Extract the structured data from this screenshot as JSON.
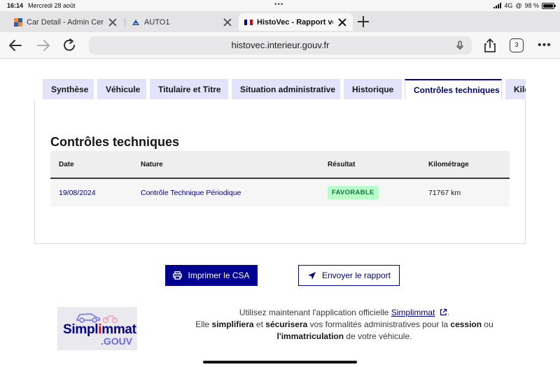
{
  "status_bar": {
    "time": "16:14",
    "date": "Mercredi 28 août",
    "network": "4G",
    "battery": "98 %"
  },
  "browser_tabs": [
    {
      "title": "Car Detail - Admin Center",
      "active": false
    },
    {
      "title": "AUTO1",
      "active": false
    },
    {
      "title": "HistoVec - Rapport vendeur",
      "active": true
    }
  ],
  "toolbar": {
    "url": "histovec.interieur.gouv.fr",
    "tab_count": "3"
  },
  "section_tabs": [
    {
      "label": "Synthèse"
    },
    {
      "label": "Véhicule"
    },
    {
      "label": "Titulaire et Titre"
    },
    {
      "label": "Situation administrative"
    },
    {
      "label": "Historique"
    },
    {
      "label": "Contrôles techniques"
    },
    {
      "label": "Kilométrage"
    }
  ],
  "panel": {
    "title": "Contrôles techniques",
    "columns": [
      "Date",
      "Nature",
      "Résultat",
      "Kilométrage"
    ],
    "rows": [
      {
        "date": "19/08/2024",
        "nature": "Contrôle Technique Périodique",
        "result": "FAVORABLE",
        "km": "71767 km"
      }
    ]
  },
  "actions": {
    "print": "Imprimer le CSA",
    "send": "Envoyer le rapport"
  },
  "promo": {
    "logo_word_1": "Simpl",
    "logo_word_2": "i",
    "logo_word_3": "mmat",
    "logo_gouv": ".GOUV",
    "line1_pre": "Utilisez maintenant l'application officielle ",
    "line1_link": "Simplimmat",
    "line1_post": ".",
    "line2_a": "Elle ",
    "line2_b": "simplifiera",
    "line2_c": " et ",
    "line2_d": "sécurisera",
    "line2_e": " vos formalités administratives pour la ",
    "line2_f": "cession",
    "line2_g": " ou",
    "line3_a": "l'immatriculation",
    "line3_b": " de votre véhicule."
  },
  "colors": {
    "primary": "#000091",
    "tab_bg": "#e3e3fd",
    "success_bg": "#b8fec9",
    "success_text": "#18753c"
  }
}
